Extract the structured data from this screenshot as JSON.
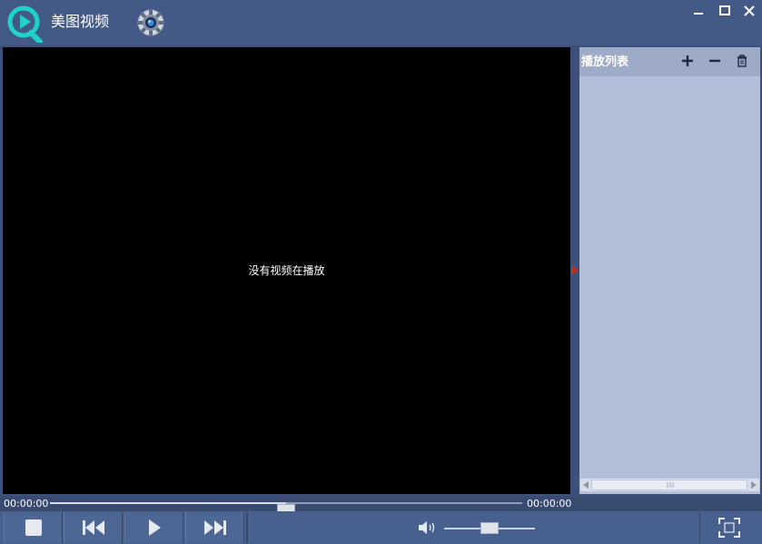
{
  "app": {
    "title": "美图视频",
    "logo_icon": "play-q-logo-icon",
    "accent_color": "#1fd2c8"
  },
  "titlebar": {
    "settings_icon": "gear-icon",
    "minimize_icon": "minimize-icon",
    "maximize_icon": "maximize-icon",
    "close_icon": "close-icon"
  },
  "video": {
    "empty_message": "没有视频在播放",
    "collapse_icon": "triangle-right-icon"
  },
  "playlist": {
    "title": "播放列表",
    "add_icon": "plus-icon",
    "remove_icon": "minus-icon",
    "clear_icon": "trash-icon",
    "items": []
  },
  "playback": {
    "elapsed": "00:00:00",
    "total": "00:00:00",
    "seek_fraction": 0.5,
    "volume_fraction": 0.5
  },
  "controls": {
    "stop_icon": "stop-icon",
    "previous_icon": "skip-back-icon",
    "play_icon": "play-icon",
    "next_icon": "skip-forward-icon",
    "volume_icon": "speaker-icon",
    "fullscreen_icon": "fullscreen-icon"
  }
}
